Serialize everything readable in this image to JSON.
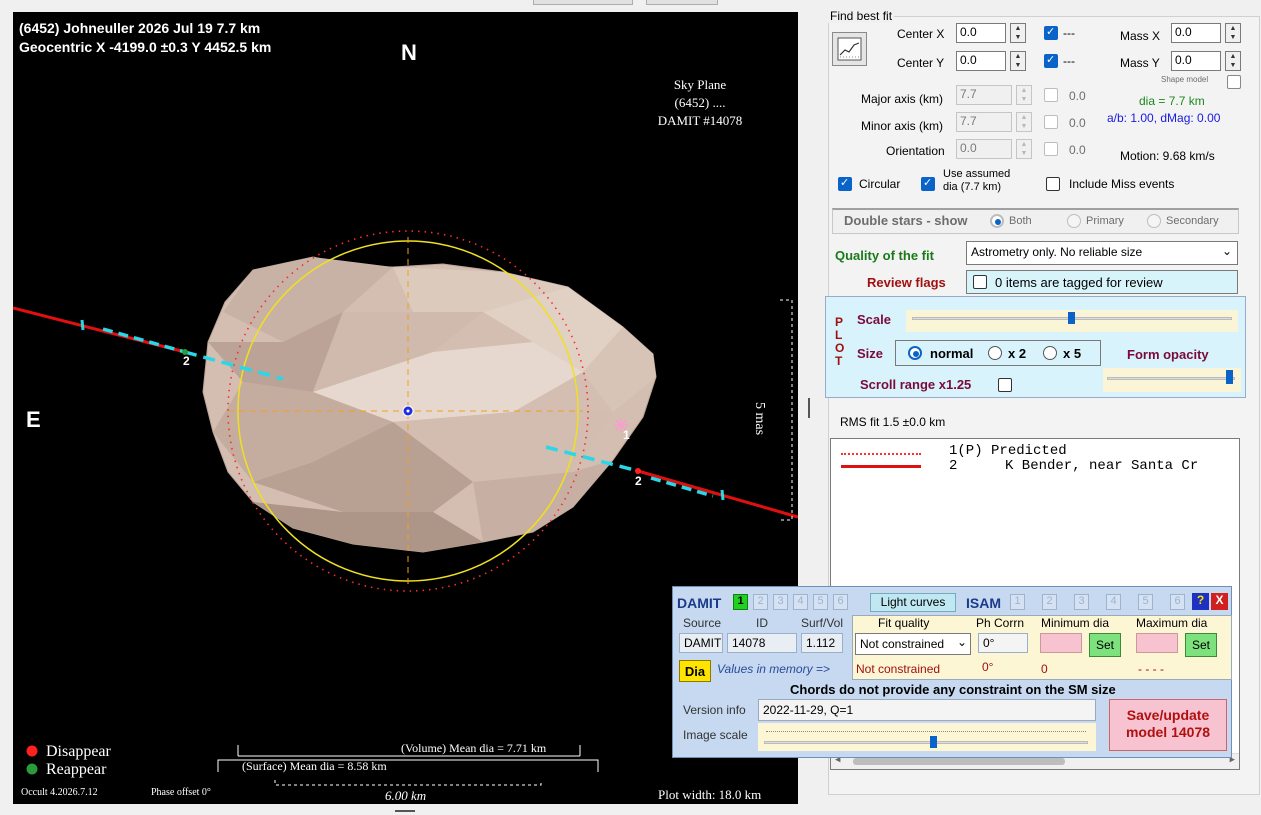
{
  "plot": {
    "title_line1": "(6452) Johneuller  2026 Jul 19   7.7 km",
    "title_line2": "Geocentric  X  -4199.0 ±0.3  Y 4452.5 km",
    "north": "N",
    "east": "E",
    "sky_plane": [
      "Sky Plane",
      "(6452) ....",
      "DAMIT #14078"
    ],
    "scale_5mas": "5 mas",
    "chord_labels": [
      "2",
      "1",
      "2"
    ],
    "legend_disappear": "Disappear",
    "legend_reappear": "Reappear",
    "volume_mean": "(Volume) Mean dia = 7.71 km",
    "surface_mean": "(Surface) Mean dia = 8.58 km",
    "scale_bar": "6.00 km",
    "version": "Occult 4.2026.7.12",
    "phase_offset": "Phase offset 0°",
    "plot_width": "Plot width: 18.0 km",
    "colors": {
      "disappear": "#ff2020",
      "reappear": "#2a9a3a",
      "chord_red": "#e01010",
      "chord_cyan": "#28d8e8",
      "circle": "#f0e020",
      "shape": "#d9c5b8"
    }
  },
  "fit": {
    "group_title": "Find best fit",
    "center_x_label": "Center X",
    "center_x_value": "0.0",
    "center_y_label": "Center Y",
    "center_y_value": "0.0",
    "dash": "---",
    "mass_x_label": "Mass X",
    "mass_x_value": "0.0",
    "mass_y_label": "Mass Y",
    "mass_y_value": "0.0",
    "shape_model": "Shape model",
    "major_label": "Major axis (km)",
    "major_value": "7.7",
    "minor_label": "Minor axis (km)",
    "minor_value": "7.7",
    "orient_label": "Orientation",
    "orient_value": "0.0",
    "zero": "0.0",
    "dia": "dia = 7.7 km",
    "ab_dmag": "a/b: 1.00, dMag: 0.00",
    "motion": "Motion: 9.68 km/s",
    "circular": "Circular",
    "use_assumed": "Use assumed",
    "use_assumed2": "dia (7.7 km)",
    "include_miss": "Include Miss events",
    "double_stars": "Double stars - show",
    "both": "Both",
    "primary": "Primary",
    "secondary": "Secondary",
    "quality_label": "Quality of the fit",
    "quality_value": "Astrometry only. No reliable size",
    "review_label": "Review flags",
    "review_value": "0 items are tagged for review"
  },
  "plotbox": {
    "vertical": [
      "P",
      "L",
      "O",
      "T"
    ],
    "scale": "Scale",
    "size": "Size",
    "normal": "normal",
    "x2": "x 2",
    "x5": "x 5",
    "form_opacity": "Form opacity",
    "scroll_range": "Scroll range x1.25"
  },
  "rms": {
    "label": "RMS fit 1.5 ±0.0 km",
    "rows": [
      {
        "index": "1(P)",
        "name": "Predicted"
      },
      {
        "index": "2",
        "name": "K Bender, near Santa Cr"
      }
    ]
  },
  "damit": {
    "title": "DAMIT",
    "tabs": [
      "1",
      "2",
      "3",
      "4",
      "5",
      "6"
    ],
    "light_curves": "Light curves",
    "isam": "ISAM",
    "isam_tabs": [
      "1",
      "2",
      "3",
      "4",
      "5",
      "6"
    ],
    "help": "?",
    "close": "X",
    "h_source": "Source",
    "h_id": "ID",
    "h_surf": "Surf/Vol",
    "h_fitq": "Fit quality",
    "h_ph": "Ph Corrn",
    "h_min": "Minimum dia",
    "h_max": "Maximum dia",
    "source": "DAMIT",
    "id": "14078",
    "surf": "1.112",
    "fit_quality": "Not constrained",
    "ph_corr": "0°",
    "set": "Set",
    "dia_btn": "Dia",
    "values_mem": "Values in memory =>",
    "mem_fit": "Not constrained",
    "mem_ph": "0°",
    "mem_min": "0",
    "mem_max": "- - - -",
    "chords_msg": "Chords do not provide any constraint on the SM size",
    "version_label": "Version info",
    "version_value": "2022-11-29, Q=1",
    "image_scale": "Image scale",
    "save_line1": "Save/update",
    "save_line2": "model 14078"
  }
}
